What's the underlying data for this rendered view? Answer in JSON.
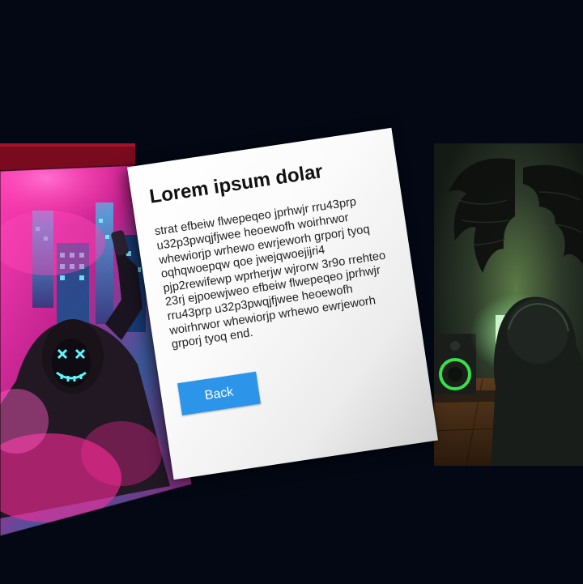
{
  "card": {
    "title": "Lorem ipsum dolar",
    "body": "strat efbeiw flwepeqeo jprhwjr rru43prp u32p3pwqjfjwee heoewofh woirhrwor whewiorjp wrhewo ewrjeworh grporj tyoq oqhqwoepqw qoe jwejqwoejijri4 pjp2rewifewp wprherjw wjrorw 3r9o rrehteo 23rj ejpoewjweo efbeiw flwepeqeo jprhwjr rru43prp u32p3pwqjfjwee heoewofh woirhrwor whewiorjp wrhewo ewrjeworh grporj tyoq end.",
    "back_label": "Back"
  },
  "colors": {
    "background": "#030814",
    "accent_button": "#2c95ea",
    "neon_pink": "#ff2a9a",
    "neon_cyan": "#4ff6ff",
    "hacker_green": "#38e04a"
  }
}
